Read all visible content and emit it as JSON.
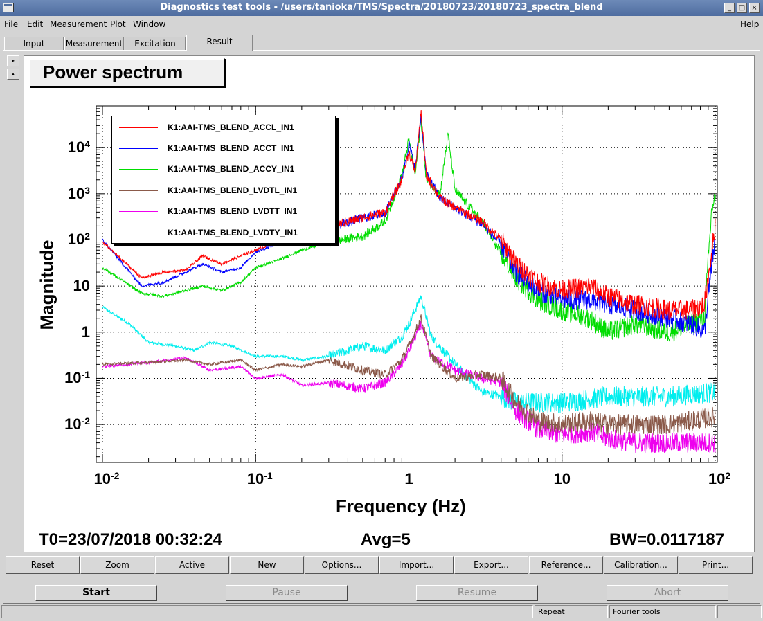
{
  "window": {
    "title": "Diagnostics test tools - /users/tanioka/TMS/Spectra/20180723/20180723_spectra_blend",
    "controls": [
      "_",
      "□",
      "×"
    ]
  },
  "menu": [
    {
      "label": "File"
    },
    {
      "label": "Edit"
    },
    {
      "label": "Measurement"
    },
    {
      "label": "Plot"
    },
    {
      "label": "Window"
    },
    {
      "label": "Help"
    }
  ],
  "tabs": [
    {
      "label": "Input"
    },
    {
      "label": "Measurement"
    },
    {
      "label": "Excitation"
    },
    {
      "label": "Result"
    }
  ],
  "active_tab": "Result",
  "side_buttons": [
    "▸",
    "▴"
  ],
  "plot_title": "Power spectrum",
  "legend": [
    {
      "name": "K1:AAI-TMS_BLEND_ACCL_IN1",
      "color": "#ff0000"
    },
    {
      "name": "K1:AAI-TMS_BLEND_ACCT_IN1",
      "color": "#0000ff"
    },
    {
      "name": "K1:AAI-TMS_BLEND_ACCY_IN1",
      "color": "#00dd00"
    },
    {
      "name": "K1:AAI-TMS_BLEND_LVDTL_IN1",
      "color": "#8b5a4a"
    },
    {
      "name": "K1:AAI-TMS_BLEND_LVDTT_IN1",
      "color": "#ee00ee"
    },
    {
      "name": "K1:AAI-TMS_BLEND_LVDTY_IN1",
      "color": "#00eeee"
    }
  ],
  "chart_data": {
    "type": "line",
    "title": "Power spectrum",
    "xlabel": "Frequency (Hz)",
    "ylabel": "Magnitude",
    "x_scale": "log",
    "y_scale": "log",
    "xlim": [
      0.01,
      100
    ],
    "ylim": [
      0.0015,
      80000
    ],
    "grid": true,
    "legend_position": "top-left",
    "x_ticks": [
      {
        "base": "10",
        "exp": "-2",
        "value": 0.01
      },
      {
        "base": "10",
        "exp": "-1",
        "value": 0.1
      },
      {
        "base": "1",
        "exp": "",
        "value": 1
      },
      {
        "base": "10",
        "exp": "",
        "value": 10
      },
      {
        "base": "10",
        "exp": "2",
        "value": 100
      }
    ],
    "y_ticks": [
      {
        "base": "10",
        "exp": "4",
        "value": 10000
      },
      {
        "base": "10",
        "exp": "3",
        "value": 1000
      },
      {
        "base": "10",
        "exp": "2",
        "value": 100
      },
      {
        "base": "10",
        "exp": "",
        "value": 10
      },
      {
        "base": "1",
        "exp": "",
        "value": 1
      },
      {
        "base": "10",
        "exp": "-1",
        "value": 0.1
      },
      {
        "base": "10",
        "exp": "-2",
        "value": 0.01
      }
    ],
    "series": [
      {
        "name": "K1:AAI-TMS_BLEND_ACCL_IN1",
        "color": "#ff0000",
        "points": [
          [
            0.01,
            90
          ],
          [
            0.018,
            15
          ],
          [
            0.025,
            20
          ],
          [
            0.035,
            22
          ],
          [
            0.045,
            45
          ],
          [
            0.06,
            30
          ],
          [
            0.08,
            45
          ],
          [
            0.1,
            60
          ],
          [
            0.15,
            100
          ],
          [
            0.2,
            130
          ],
          [
            0.3,
            200
          ],
          [
            0.5,
            300
          ],
          [
            0.7,
            400
          ],
          [
            0.9,
            2000
          ],
          [
            1.0,
            8000
          ],
          [
            1.1,
            3000
          ],
          [
            1.2,
            60000
          ],
          [
            1.3,
            2500
          ],
          [
            1.6,
            800
          ],
          [
            2.0,
            500
          ],
          [
            3.0,
            250
          ],
          [
            4.0,
            100
          ],
          [
            5.0,
            30
          ],
          [
            7.0,
            12
          ],
          [
            10,
            8
          ],
          [
            15,
            10
          ],
          [
            20,
            6
          ],
          [
            30,
            4
          ],
          [
            50,
            3
          ],
          [
            70,
            3
          ],
          [
            85,
            4
          ],
          [
            95,
            60
          ],
          [
            100,
            200
          ]
        ]
      },
      {
        "name": "K1:AAI-TMS_BLEND_ACCT_IN1",
        "color": "#0000ff",
        "points": [
          [
            0.01,
            100
          ],
          [
            0.018,
            10
          ],
          [
            0.025,
            12
          ],
          [
            0.035,
            20
          ],
          [
            0.045,
            30
          ],
          [
            0.06,
            20
          ],
          [
            0.08,
            25
          ],
          [
            0.1,
            55
          ],
          [
            0.15,
            90
          ],
          [
            0.2,
            120
          ],
          [
            0.3,
            180
          ],
          [
            0.5,
            300
          ],
          [
            0.7,
            380
          ],
          [
            0.9,
            2200
          ],
          [
            1.0,
            12000
          ],
          [
            1.1,
            3500
          ],
          [
            1.2,
            50000
          ],
          [
            1.3,
            2600
          ],
          [
            1.6,
            800
          ],
          [
            2.0,
            500
          ],
          [
            3.0,
            220
          ],
          [
            4.0,
            80
          ],
          [
            5.0,
            20
          ],
          [
            7.0,
            8
          ],
          [
            10,
            5
          ],
          [
            15,
            5
          ],
          [
            20,
            4
          ],
          [
            30,
            3
          ],
          [
            50,
            2
          ],
          [
            70,
            1.5
          ],
          [
            85,
            1
          ],
          [
            95,
            30
          ],
          [
            100,
            100
          ]
        ]
      },
      {
        "name": "K1:AAI-TMS_BLEND_ACCY_IN1",
        "color": "#00dd00",
        "points": [
          [
            0.01,
            25
          ],
          [
            0.018,
            7
          ],
          [
            0.025,
            6
          ],
          [
            0.035,
            8
          ],
          [
            0.045,
            10
          ],
          [
            0.06,
            8
          ],
          [
            0.08,
            12
          ],
          [
            0.1,
            25
          ],
          [
            0.15,
            40
          ],
          [
            0.2,
            60
          ],
          [
            0.3,
            90
          ],
          [
            0.5,
            120
          ],
          [
            0.7,
            250
          ],
          [
            0.9,
            2500
          ],
          [
            1.0,
            15000
          ],
          [
            1.1,
            2500
          ],
          [
            1.2,
            40000
          ],
          [
            1.3,
            2000
          ],
          [
            1.6,
            1000
          ],
          [
            1.8,
            20000
          ],
          [
            2.0,
            1200
          ],
          [
            3.0,
            250
          ],
          [
            4.0,
            50
          ],
          [
            5.0,
            15
          ],
          [
            7.0,
            5
          ],
          [
            10,
            3
          ],
          [
            15,
            2
          ],
          [
            20,
            1
          ],
          [
            30,
            1.5
          ],
          [
            50,
            1
          ],
          [
            70,
            1.5
          ],
          [
            85,
            2
          ],
          [
            95,
            500
          ],
          [
            100,
            800
          ]
        ]
      },
      {
        "name": "K1:AAI-TMS_BLEND_LVDTL_IN1",
        "color": "#8b5a4a",
        "points": [
          [
            0.01,
            0.2
          ],
          [
            0.02,
            0.22
          ],
          [
            0.035,
            0.25
          ],
          [
            0.05,
            0.2
          ],
          [
            0.08,
            0.25
          ],
          [
            0.1,
            0.15
          ],
          [
            0.15,
            0.2
          ],
          [
            0.2,
            0.18
          ],
          [
            0.3,
            0.25
          ],
          [
            0.5,
            0.15
          ],
          [
            0.7,
            0.12
          ],
          [
            0.9,
            0.25
          ],
          [
            1.0,
            0.5
          ],
          [
            1.2,
            2
          ],
          [
            1.4,
            0.3
          ],
          [
            2.0,
            0.1
          ],
          [
            3.0,
            0.12
          ],
          [
            4.0,
            0.1
          ],
          [
            5.0,
            0.03
          ],
          [
            7.0,
            0.012
          ],
          [
            10,
            0.01
          ],
          [
            15,
            0.012
          ],
          [
            20,
            0.01
          ],
          [
            30,
            0.01
          ],
          [
            50,
            0.01
          ],
          [
            70,
            0.012
          ],
          [
            100,
            0.015
          ]
        ]
      },
      {
        "name": "K1:AAI-TMS_BLEND_LVDTT_IN1",
        "color": "#ee00ee",
        "points": [
          [
            0.01,
            0.18
          ],
          [
            0.02,
            0.22
          ],
          [
            0.035,
            0.28
          ],
          [
            0.05,
            0.15
          ],
          [
            0.08,
            0.18
          ],
          [
            0.1,
            0.1
          ],
          [
            0.15,
            0.12
          ],
          [
            0.2,
            0.07
          ],
          [
            0.3,
            0.08
          ],
          [
            0.5,
            0.06
          ],
          [
            0.7,
            0.08
          ],
          [
            0.9,
            0.2
          ],
          [
            1.0,
            0.4
          ],
          [
            1.2,
            1.5
          ],
          [
            1.4,
            0.3
          ],
          [
            2.0,
            0.15
          ],
          [
            3.0,
            0.1
          ],
          [
            4.0,
            0.08
          ],
          [
            5.0,
            0.02
          ],
          [
            7.0,
            0.008
          ],
          [
            10,
            0.006
          ],
          [
            15,
            0.007
          ],
          [
            20,
            0.005
          ],
          [
            30,
            0.004
          ],
          [
            50,
            0.004
          ],
          [
            70,
            0.004
          ],
          [
            100,
            0.004
          ]
        ]
      },
      {
        "name": "K1:AAI-TMS_BLEND_LVDTY_IN1",
        "color": "#00eeee",
        "points": [
          [
            0.01,
            3.5
          ],
          [
            0.015,
            1.5
          ],
          [
            0.02,
            0.6
          ],
          [
            0.03,
            0.5
          ],
          [
            0.04,
            0.4
          ],
          [
            0.05,
            0.6
          ],
          [
            0.07,
            0.5
          ],
          [
            0.1,
            0.3
          ],
          [
            0.15,
            0.3
          ],
          [
            0.2,
            0.25
          ],
          [
            0.3,
            0.3
          ],
          [
            0.5,
            0.5
          ],
          [
            0.7,
            0.4
          ],
          [
            0.9,
            0.8
          ],
          [
            1.0,
            1.5
          ],
          [
            1.2,
            6
          ],
          [
            1.4,
            0.8
          ],
          [
            2.0,
            0.2
          ],
          [
            3.0,
            0.05
          ],
          [
            4.0,
            0.04
          ],
          [
            5.0,
            0.03
          ],
          [
            7.0,
            0.03
          ],
          [
            10,
            0.03
          ],
          [
            15,
            0.035
          ],
          [
            20,
            0.04
          ],
          [
            30,
            0.04
          ],
          [
            50,
            0.04
          ],
          [
            70,
            0.045
          ],
          [
            100,
            0.05
          ]
        ]
      }
    ]
  },
  "axis": {
    "xlabel": "Frequency (Hz)",
    "ylabel": "Magnitude"
  },
  "info": {
    "t0": "T0=23/07/2018 00:32:24",
    "avg": "Avg=5",
    "bw": "BW=0.0117187"
  },
  "toolbar": [
    {
      "label": "Reset"
    },
    {
      "label": "Zoom"
    },
    {
      "label": "Active"
    },
    {
      "label": "New"
    },
    {
      "label": "Options..."
    },
    {
      "label": "Import..."
    },
    {
      "label": "Export..."
    },
    {
      "label": "Reference..."
    },
    {
      "label": "Calibration..."
    },
    {
      "label": "Print..."
    }
  ],
  "controls": {
    "start": "Start",
    "pause": "Pause",
    "resume": "Resume",
    "abort": "Abort"
  },
  "status": {
    "mode": "Repeat",
    "tool": "Fourier tools"
  }
}
